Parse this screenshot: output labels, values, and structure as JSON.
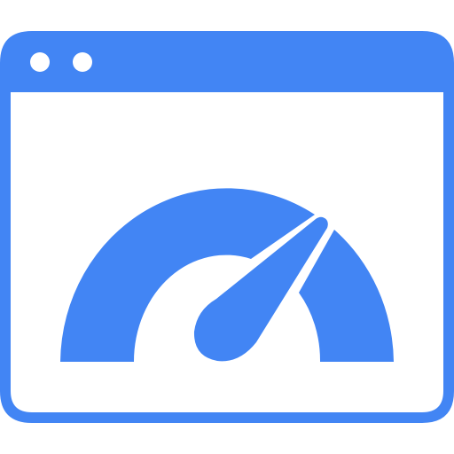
{
  "icon": {
    "name": "browser-window-speedometer",
    "color": "#4285F4",
    "background": "#FFFFFF"
  },
  "window": {
    "title_bar_dots": [
      "window-dot",
      "window-dot"
    ]
  },
  "gauge": {
    "needle_direction": "upper-right"
  }
}
